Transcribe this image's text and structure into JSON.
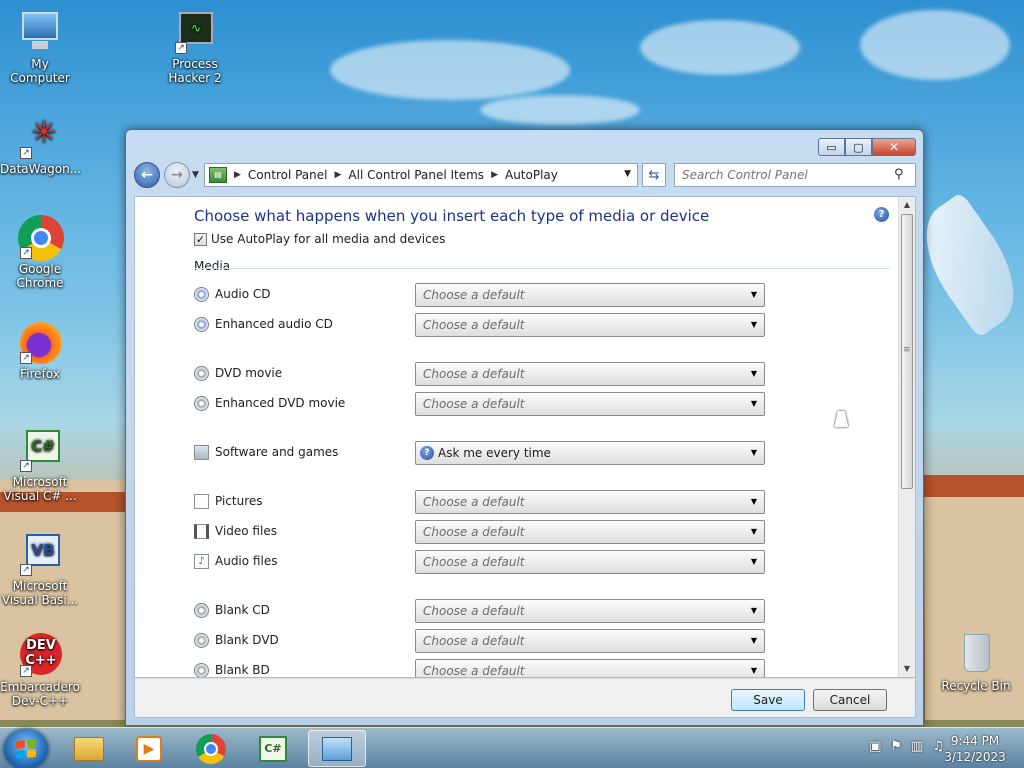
{
  "desktop": {
    "icons": [
      {
        "label": "My Computer"
      },
      {
        "label": "Process Hacker 2"
      },
      {
        "label": "DataWagon..."
      },
      {
        "label": "Google Chrome"
      },
      {
        "label": "Firefox"
      },
      {
        "label": "Microsoft Visual C# ..."
      },
      {
        "label": "Microsoft Visual Basi..."
      },
      {
        "label": "Embarcadero Dev-C++"
      },
      {
        "label": "Recycle Bin"
      }
    ]
  },
  "window": {
    "breadcrumb": [
      "Control Panel",
      "All Control Panel Items",
      "AutoPlay"
    ],
    "search_placeholder": "Search Control Panel",
    "caption": {
      "minimize": "▭",
      "maximize": "▢",
      "close": "✕"
    }
  },
  "autoplay": {
    "title": "Choose what happens when you insert each type of media or device",
    "use_autoplay_label": "Use AutoPlay for all media and devices",
    "use_autoplay_checked": true,
    "section_media": "Media",
    "items": [
      {
        "label": "Audio CD",
        "value": "Choose a default",
        "icon": "audio-cd-icon"
      },
      {
        "label": "Enhanced audio CD",
        "value": "Choose a default",
        "icon": "enhanced-audio-cd-icon"
      },
      {
        "label": "DVD movie",
        "value": "Choose a default",
        "icon": "dvd-movie-icon"
      },
      {
        "label": "Enhanced DVD movie",
        "value": "Choose a default",
        "icon": "enhanced-dvd-movie-icon"
      },
      {
        "label": "Software and games",
        "value": "Ask me every time",
        "icon": "software-games-icon"
      },
      {
        "label": "Pictures",
        "value": "Choose a default",
        "icon": "pictures-icon"
      },
      {
        "label": "Video files",
        "value": "Choose a default",
        "icon": "video-files-icon"
      },
      {
        "label": "Audio files",
        "value": "Choose a default",
        "icon": "audio-files-icon"
      },
      {
        "label": "Blank CD",
        "value": "Choose a default",
        "icon": "blank-cd-icon"
      },
      {
        "label": "Blank DVD",
        "value": "Choose a default",
        "icon": "blank-dvd-icon"
      },
      {
        "label": "Blank BD",
        "value": "Choose a default",
        "icon": "blank-bd-icon"
      }
    ],
    "save_label": "Save",
    "cancel_label": "Cancel"
  },
  "taskbar": {
    "time": "9:44 PM",
    "date": "3/12/2023",
    "items": [
      "windows-explorer-icon",
      "media-player-icon",
      "chrome-icon",
      "visual-csharp-icon",
      "control-panel-icon"
    ]
  }
}
